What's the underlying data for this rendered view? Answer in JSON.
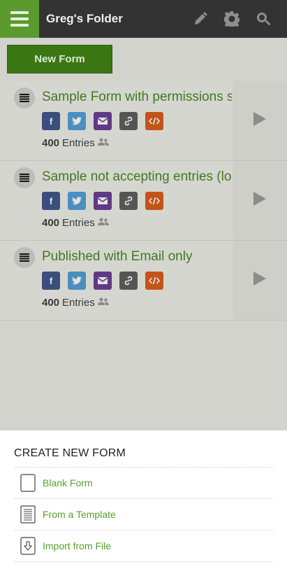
{
  "header": {
    "title": "Greg's Folder"
  },
  "toolbar": {
    "new_form_label": "New Form"
  },
  "forms": [
    {
      "title": "Sample Form with permissions set",
      "entries_count": "400",
      "entries_label": "Entries"
    },
    {
      "title": "Sample not accepting entries (locked)",
      "entries_count": "400",
      "entries_label": "Entries"
    },
    {
      "title": "Published with Email only",
      "entries_count": "400",
      "entries_label": "Entries"
    }
  ],
  "share_icons": [
    "facebook-icon",
    "twitter-icon",
    "email-icon",
    "link-icon",
    "embed-icon"
  ],
  "colors": {
    "brand_green": "#5a9a2e",
    "facebook": "#3b4f7e",
    "twitter": "#4a8fbf",
    "email": "#5e3a86",
    "link": "#555555",
    "embed": "#c2541a"
  },
  "create_sheet": {
    "title": "CREATE NEW FORM",
    "options": [
      {
        "label": "Blank Form",
        "icon": "blank-page-icon"
      },
      {
        "label": "From a Template",
        "icon": "template-page-icon"
      },
      {
        "label": "Import from File",
        "icon": "import-file-icon"
      }
    ]
  }
}
